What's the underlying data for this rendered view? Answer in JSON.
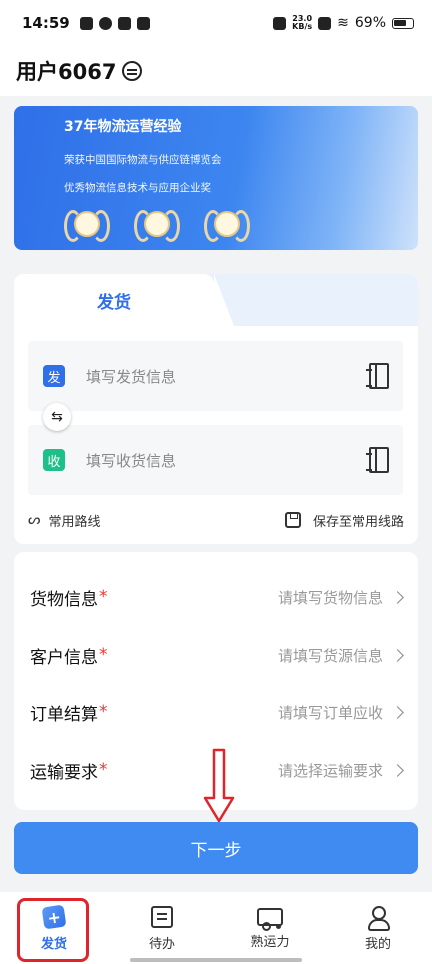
{
  "status_bar": {
    "time": "14:59",
    "net_speed_value": "23.0",
    "net_speed_unit": "KB/s",
    "battery": "69%"
  },
  "header": {
    "title": "用户6067"
  },
  "banner": {
    "title": "37年物流运营经验",
    "line1": "荣获中国国际物流与供应链博览会",
    "line2": "优秀物流信息技术与应用企业奖"
  },
  "ship_card": {
    "tab_active": "发货",
    "sender": {
      "tag": "发",
      "placeholder": "填写发货信息"
    },
    "receiver": {
      "tag": "收",
      "placeholder": "填写收货信息"
    },
    "common_routes": "常用路线",
    "save_route": "保存至常用线路"
  },
  "form": {
    "rows": [
      {
        "label": "货物信息",
        "hint": "请填写货物信息"
      },
      {
        "label": "客户信息",
        "hint": "请填写货源信息"
      },
      {
        "label": "订单结算",
        "hint": "请填写订单应收"
      },
      {
        "label": "运输要求",
        "hint": "请选择运输要求"
      }
    ],
    "required_mark": "*"
  },
  "next_button": "下一步",
  "tabbar": {
    "items": [
      {
        "label": "发货",
        "icon": "ship-icon",
        "active": true
      },
      {
        "label": "待办",
        "icon": "todo-icon",
        "active": false
      },
      {
        "label": "熟运力",
        "icon": "truck-icon",
        "active": false
      },
      {
        "label": "我的",
        "icon": "user-icon",
        "active": false
      }
    ]
  },
  "colors": {
    "primary": "#2f6fe8",
    "button": "#3f8bf2",
    "receive_tag": "#1fbf8a",
    "required": "#e53935",
    "highlight": "#e0242b"
  }
}
